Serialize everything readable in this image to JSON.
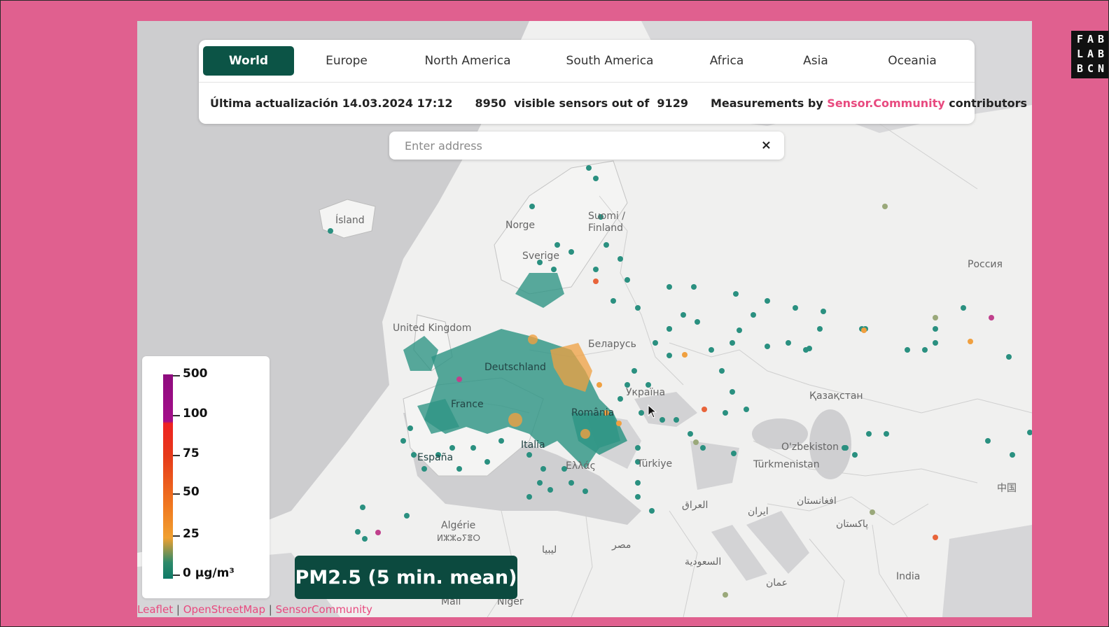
{
  "tabs": [
    "World",
    "Europe",
    "North America",
    "South America",
    "Africa",
    "Asia",
    "Oceania"
  ],
  "active_tab": "World",
  "info": {
    "last_update_label": "Última actualización",
    "last_update_value": "14.03.2024 17:12",
    "visible_sensors": "8950",
    "visible_sensors_text": "visible sensors out of",
    "total_sensors": "9129",
    "measurements_prefix": "Measurements by",
    "community_link": "Sensor.Community",
    "measurements_suffix": "contributors"
  },
  "search": {
    "placeholder": "Enter address",
    "clear_symbol": "×"
  },
  "legend": {
    "labels": [
      "500",
      "100",
      "75",
      "50",
      "25",
      "0 µg/m³"
    ],
    "colors": {
      "high": "#8e0c7e",
      "mid": "#e63a1a",
      "low_mid": "#f0a030",
      "low": "#0f7a68"
    }
  },
  "badge": "PM2.5 (5 min. mean)",
  "attribution": [
    "Leaflet",
    "OpenStreetMap",
    "SensorCommunity"
  ],
  "logo": [
    "FAB",
    "LAB",
    "BCN"
  ],
  "map_labels": {
    "island": "Ísland",
    "norge": "Norge",
    "suomi": "Suomi /",
    "finland": "Finland",
    "sverige": "Sverige",
    "uk": "United Kingdom",
    "deutschland": "Deutschland",
    "france": "France",
    "espana": "España",
    "italia": "Italia",
    "romania": "România",
    "ellada": "Ελλάς",
    "belarus": "Беларусь",
    "ukraina": "Україна",
    "turkiye": "Türkiye",
    "russia": "Россия",
    "kazakhstan": "Қазақстан",
    "uzbekistan": "O'zbekiston",
    "turkmenistan": "Türkmenistan",
    "algerie": "Algérie",
    "algerie_tif": "ⵍⵣⵣⴰⵢⴻⵔ",
    "libya": "ليبيا",
    "misr": "مصر",
    "saudi": "السعودية",
    "iraq": "العراق",
    "iran": "ایران",
    "afghanistan": "افغانستان",
    "pakistan": "پاکستان",
    "oman": "عمان",
    "india": "India",
    "china": "中国",
    "mali": "Mali",
    "niger": "Niger"
  }
}
